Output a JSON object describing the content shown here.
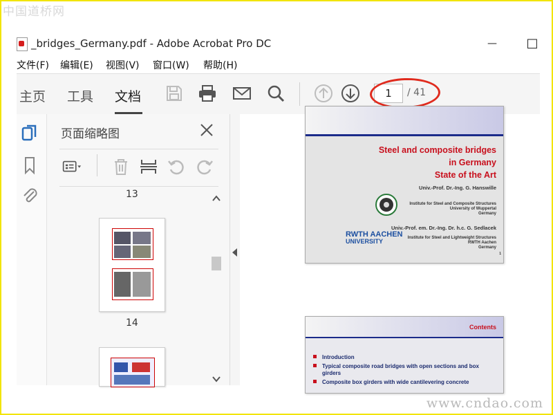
{
  "watermarks": {
    "top": "中国道桥网",
    "bottom": "www.cndao.com"
  },
  "window": {
    "title": "_bridges_Germany.pdf - Adobe Acrobat Pro DC",
    "minimize": "—",
    "maximize": "□"
  },
  "menu": [
    {
      "label": "文件(F)"
    },
    {
      "label": "编辑(E)"
    },
    {
      "label": "视图(V)"
    },
    {
      "label": "窗口(W)"
    },
    {
      "label": "帮助(H)"
    }
  ],
  "toolbar": {
    "tabs": [
      {
        "label": "主页"
      },
      {
        "label": "工具"
      },
      {
        "label": "文档"
      }
    ],
    "active_tab": "文档",
    "page_current": "1",
    "page_total": "/ 41",
    "highlight_color": "#e02b1e"
  },
  "panel": {
    "title": "页面缩略图",
    "thumbnails": [
      {
        "label": "13"
      },
      {
        "label": "14"
      }
    ]
  },
  "document": {
    "page1": {
      "title_lines": [
        "Steel and composite bridges",
        "in Germany",
        "State of the Art"
      ],
      "author1": "Univ.-Prof. Dr.-Ing. G. Hanswille",
      "inst1_lines": [
        "Institute for Steel and Composite Structures",
        "University of Wuppertal",
        "Germany"
      ],
      "author2": "Univ.-Prof. em. Dr.-Ing. Dr. h.c. G. Sedlacek",
      "inst2_lines": [
        "Institute for Steel and Lightweight Structures",
        "RWTH Aachen",
        "Germany"
      ],
      "logo_lines": [
        "RWTH AACHEN",
        "UNIVERSITY"
      ],
      "page_no": "1"
    },
    "page2": {
      "heading": "Contents",
      "items": [
        "Introduction",
        "Typical composite road bridges with open sections and box girders",
        "Composite box girders with wide cantilevering concrete"
      ]
    }
  },
  "colors": {
    "accent_red": "#c8101d",
    "acrobat_blue": "#2a6ebb",
    "frame_yellow": "#f2e400"
  }
}
